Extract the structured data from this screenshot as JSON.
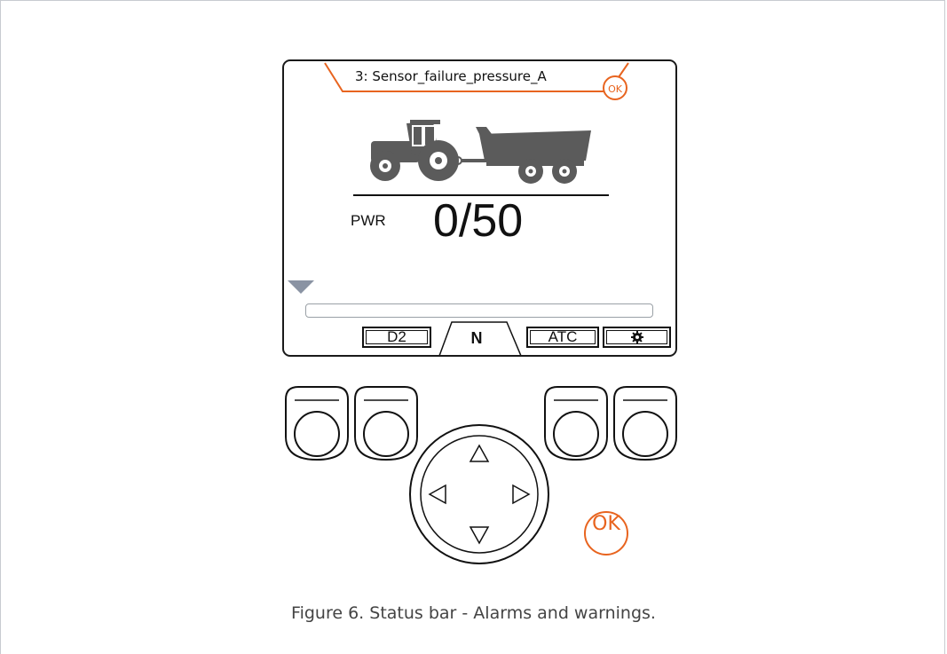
{
  "alarm": {
    "message": "3: Sensor_failure_pressure_A",
    "ok_label": "OK"
  },
  "display": {
    "param_label": "PWR",
    "param_value": "0/50"
  },
  "softkeys": {
    "left": "D2",
    "tab": "N",
    "right": "ATC",
    "settings_icon": "gear-icon"
  },
  "keypad": {
    "ok_label": "OK",
    "arrows": [
      "up-arrow-icon",
      "left-arrow-icon",
      "right-arrow-icon",
      "down-arrow-icon"
    ]
  },
  "colors": {
    "accent": "#e8641f",
    "vehicle": "#5b5b5b",
    "marker": "#8a93a3"
  },
  "caption": "Figure 6. Status bar - Alarms and warnings."
}
